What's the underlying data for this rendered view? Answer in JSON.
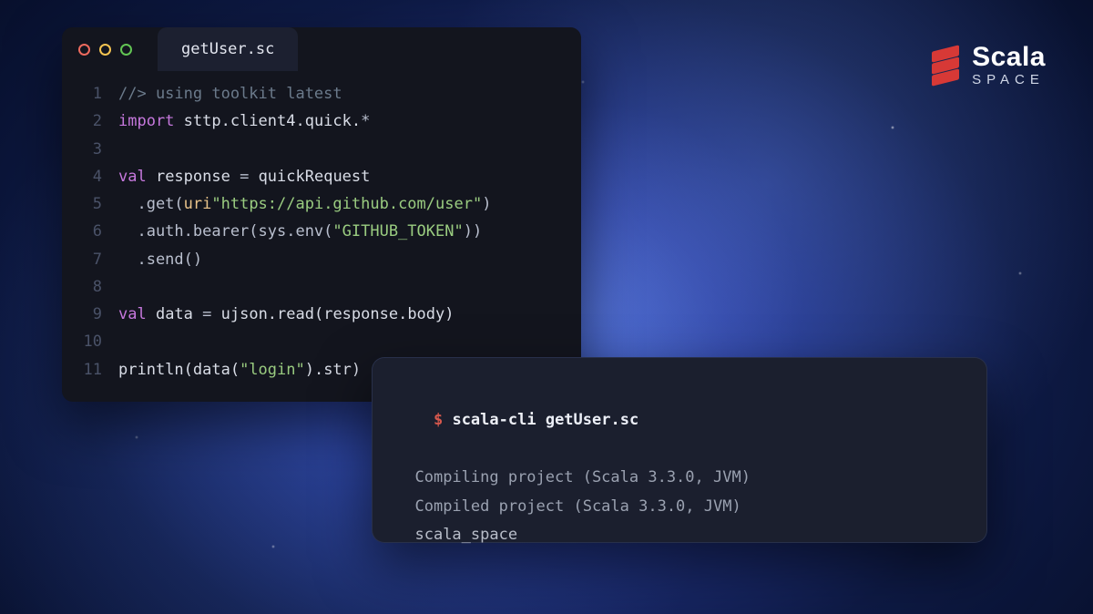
{
  "logo": {
    "title": "Scala",
    "subtitle": "SPACE"
  },
  "editor": {
    "filename": "getUser.sc",
    "lines": [
      {
        "n": "1",
        "segs": [
          {
            "t": "//> using toolkit latest",
            "c": "c-comment"
          }
        ]
      },
      {
        "n": "2",
        "segs": [
          {
            "t": "import",
            "c": "c-kw"
          },
          {
            "t": " sttp.client4.quick.",
            "c": "c-ident"
          },
          {
            "t": "*",
            "c": "c-punct"
          }
        ]
      },
      {
        "n": "3",
        "segs": [
          {
            "t": "",
            "c": "c-ident"
          }
        ]
      },
      {
        "n": "4",
        "segs": [
          {
            "t": "val",
            "c": "c-kw"
          },
          {
            "t": " response ",
            "c": "c-ident"
          },
          {
            "t": "=",
            "c": "c-punct"
          },
          {
            "t": " quickRequest",
            "c": "c-ident"
          }
        ]
      },
      {
        "n": "5",
        "segs": [
          {
            "t": "  .get(",
            "c": "c-punct"
          },
          {
            "t": "uri",
            "c": "c-prefix"
          },
          {
            "t": "\"https://api.github.com/user\"",
            "c": "c-str"
          },
          {
            "t": ")",
            "c": "c-punct"
          }
        ]
      },
      {
        "n": "6",
        "segs": [
          {
            "t": "  .auth.bearer(sys.env(",
            "c": "c-punct"
          },
          {
            "t": "\"GITHUB_TOKEN\"",
            "c": "c-str"
          },
          {
            "t": "))",
            "c": "c-punct"
          }
        ]
      },
      {
        "n": "7",
        "segs": [
          {
            "t": "  .send()",
            "c": "c-punct"
          }
        ]
      },
      {
        "n": "8",
        "segs": [
          {
            "t": "",
            "c": "c-ident"
          }
        ]
      },
      {
        "n": "9",
        "segs": [
          {
            "t": "val",
            "c": "c-kw"
          },
          {
            "t": " data ",
            "c": "c-ident"
          },
          {
            "t": "=",
            "c": "c-punct"
          },
          {
            "t": " ujson.read(response.body)",
            "c": "c-func"
          }
        ]
      },
      {
        "n": "10",
        "segs": [
          {
            "t": "",
            "c": "c-ident"
          }
        ]
      },
      {
        "n": "11",
        "segs": [
          {
            "t": "println(data(",
            "c": "c-func"
          },
          {
            "t": "\"login\"",
            "c": "c-str"
          },
          {
            "t": ").str)",
            "c": "c-func"
          }
        ]
      }
    ]
  },
  "terminal": {
    "prompt": "$",
    "command": "scala-cli",
    "arg": "getUser.sc",
    "output": [
      "Compiling project (Scala 3.3.0, JVM)",
      "Compiled project (Scala 3.3.0, JVM)",
      "scala_space"
    ]
  }
}
